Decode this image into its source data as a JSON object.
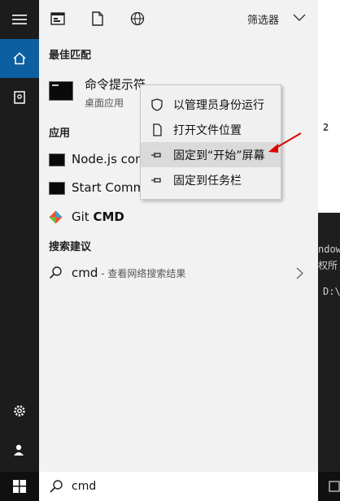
{
  "filter": {
    "label": "筛选器"
  },
  "best_match": {
    "title": "最佳匹配",
    "item": {
      "name": "命令提示符",
      "subtitle": "桌面应用"
    }
  },
  "apps": {
    "title": "应用",
    "items": [
      {
        "name": "Node.js con"
      },
      {
        "name": "Start Comm"
      },
      {
        "name_prefix": "Git ",
        "name_bold": "CMD"
      }
    ]
  },
  "suggestions": {
    "title": "搜索建议",
    "item": {
      "term": "cmd",
      "desc": " - 查看网络搜索结果"
    }
  },
  "context_menu": {
    "items": [
      {
        "label": "以管理员身份运行"
      },
      {
        "label": "打开文件位置"
      },
      {
        "label": "固定到“开始”屏幕"
      },
      {
        "label": "固定到任务栏"
      }
    ]
  },
  "search": {
    "value": "cmd"
  },
  "background": {
    "line1": "2",
    "line2": "ndow",
    "line3": "权所",
    "line4": "D:\\"
  },
  "colors": {
    "accent": "#0c5fa0",
    "annotation_arrow": "#e00000"
  }
}
